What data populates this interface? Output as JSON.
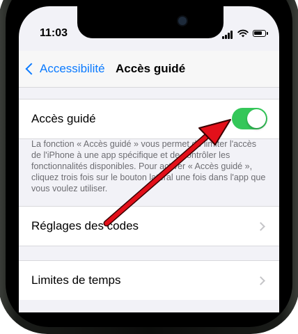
{
  "status_bar": {
    "time": "11:03",
    "icons": [
      "signal-icon",
      "wifi-icon",
      "battery-icon"
    ]
  },
  "navbar": {
    "back_label": "Accessibilité",
    "title": "Accès guidé"
  },
  "guided_access": {
    "label": "Accès guidé",
    "toggle_state": "on",
    "description": "La fonction « Accès guidé » vous permet de limiter l'accès de l'iPhone à une app spécifique et de contrôler les fonctionnalités disponibles. Pour activer « Accès guidé », cliquez trois fois sur le bouton latéral une fois dans l'app que vous voulez utiliser."
  },
  "settings_rows": [
    {
      "label": "Réglages des codes"
    },
    {
      "label": "Limites de temps"
    }
  ],
  "colors": {
    "accent": "#0a7aff",
    "toggle_on": "#34c759",
    "annotation_arrow": "#e3101a"
  }
}
